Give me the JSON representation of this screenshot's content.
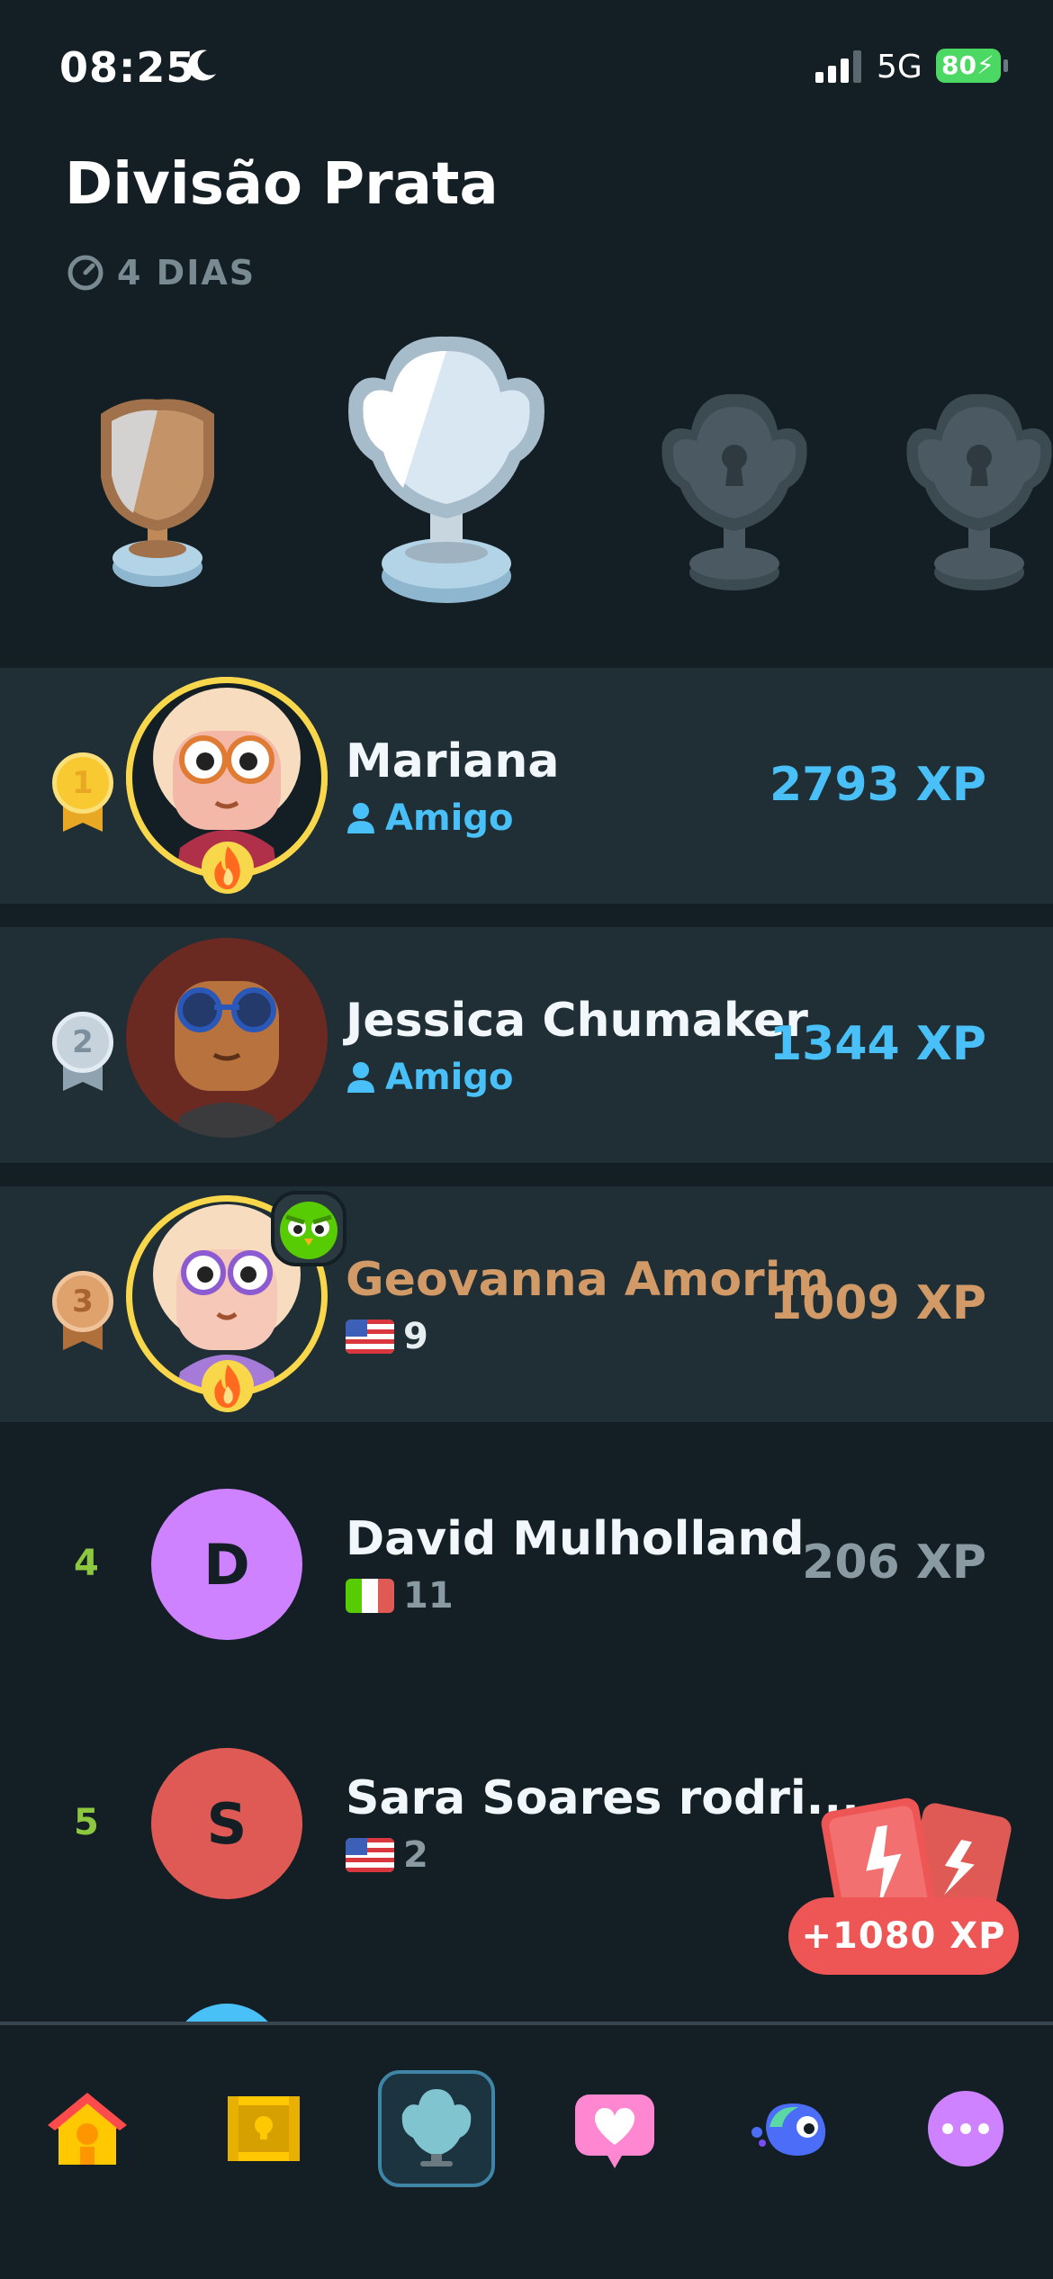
{
  "status": {
    "time": "08:25",
    "network": "5G",
    "battery": "80"
  },
  "header": {
    "title": "Divisão Prata",
    "timer": "4 DIAS"
  },
  "colors": {
    "background": "#131f24",
    "highlight_row": "#202f36",
    "friend_blue": "#49c0f8",
    "rank_green": "#8dc63f",
    "gold": "#f9d74b",
    "xp_gold": "#d19a66",
    "boost_red": "#ee5555"
  },
  "leaderboard": [
    {
      "rank": "1",
      "name": "Mariana",
      "sub_label": "Amigo",
      "sub_icon": "person-icon",
      "xp": "2793 XP",
      "avatar": "avatar-mariana",
      "streak": true
    },
    {
      "rank": "2",
      "name": "Jessica Chumaker",
      "sub_label": "Amigo",
      "sub_icon": "person-icon",
      "xp": "1344 XP",
      "avatar": "avatar-jessica",
      "streak": false
    },
    {
      "rank": "3",
      "name": "Geovanna Amorim",
      "sub_label": "9",
      "sub_icon": "us-flag-icon",
      "xp": "1009 XP",
      "avatar": "avatar-geovanna",
      "streak": true
    },
    {
      "rank": "4",
      "name": "David Mulholland",
      "sub_label": "11",
      "sub_icon": "italy-flag-icon",
      "xp": "206 XP",
      "avatar_letter": "D",
      "avatar_color": "#ce82ff"
    },
    {
      "rank": "5",
      "name": "Sara Soares rodri...",
      "sub_label": "2",
      "sub_icon": "us-flag-icon",
      "xp": "",
      "avatar_letter": "S",
      "avatar_color": "#e05a55"
    }
  ],
  "boost": {
    "label": "+1080 XP"
  },
  "nav": [
    "home-icon",
    "treasure-chest-icon",
    "leagues-trophy-icon",
    "hearts-icon",
    "duo-bird-icon",
    "more-icon"
  ]
}
